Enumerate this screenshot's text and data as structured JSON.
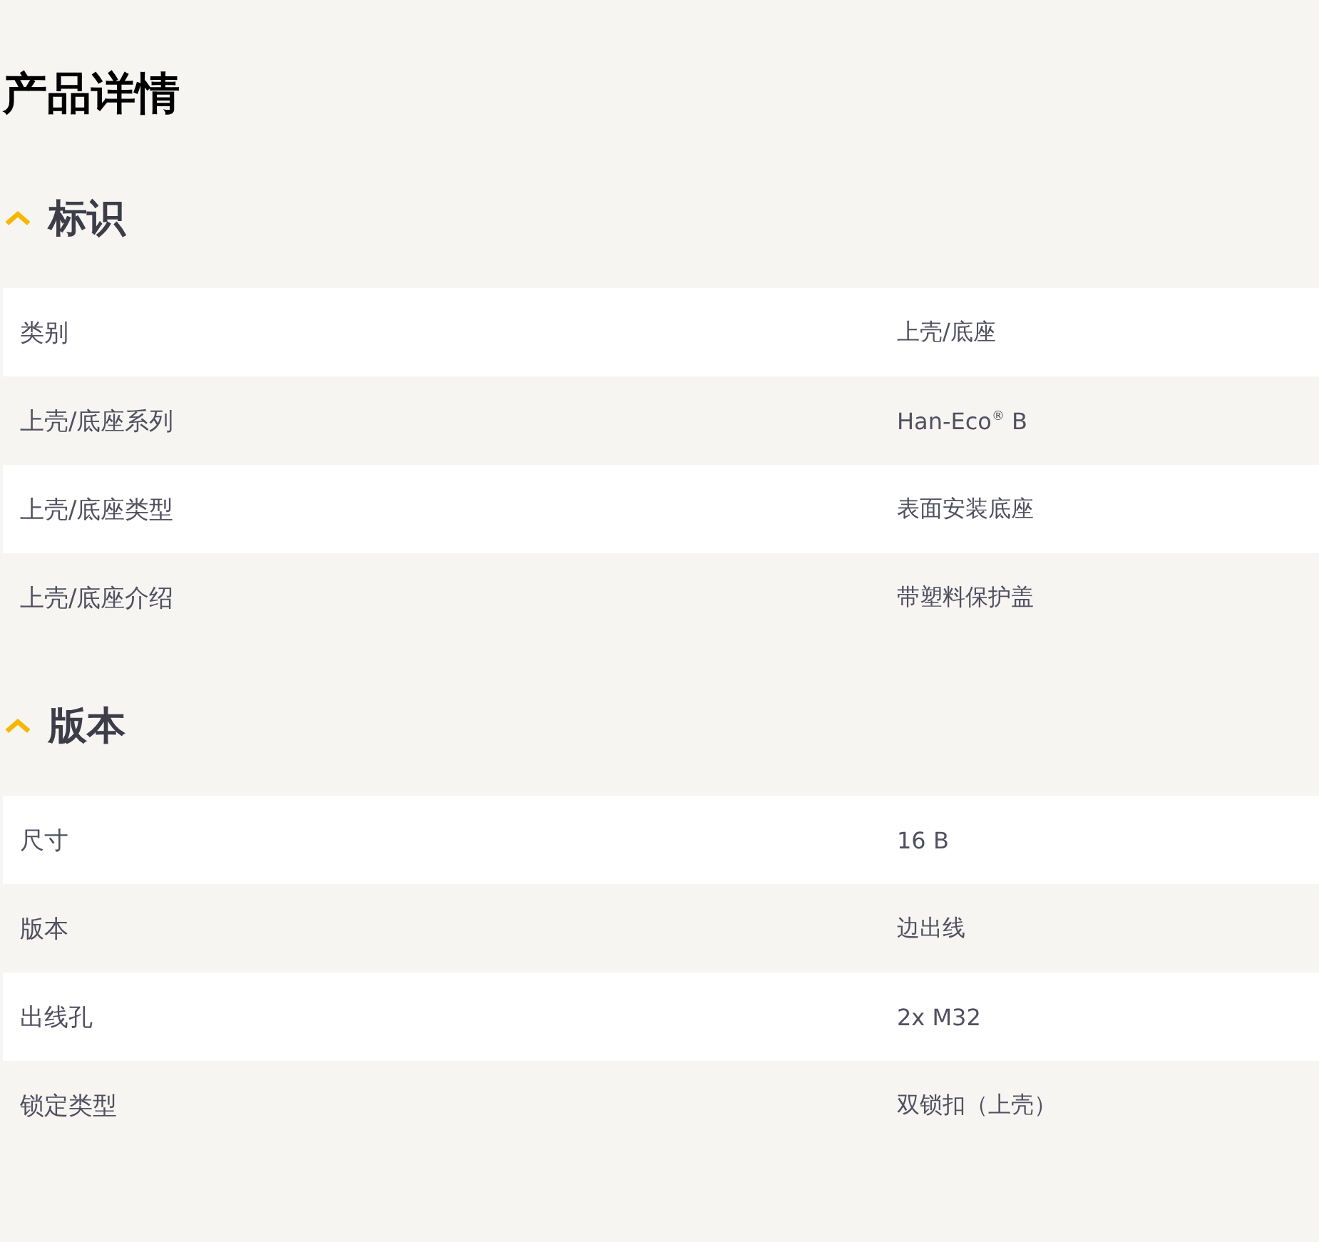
{
  "title": "产品详情",
  "sections": [
    {
      "title": "标识",
      "expanded": true,
      "rows": [
        {
          "label": "类别",
          "value": "上壳/底座"
        },
        {
          "label": "上壳/底座系列",
          "value": "Han-Eco$^{®}$ B"
        },
        {
          "label": "上壳/底座类型",
          "value": "表面安装底座"
        },
        {
          "label": "上壳/底座介绍",
          "value": "带塑料保护盖"
        }
      ]
    },
    {
      "title": "版本",
      "expanded": true,
      "rows": [
        {
          "label": "尺寸",
          "value": "16 B"
        },
        {
          "label": "版本",
          "value": "边出线"
        },
        {
          "label": "出线孔",
          "value": "2x M32"
        },
        {
          "label": "锁定类型",
          "value": "双锁扣（上壳）"
        }
      ]
    }
  ]
}
